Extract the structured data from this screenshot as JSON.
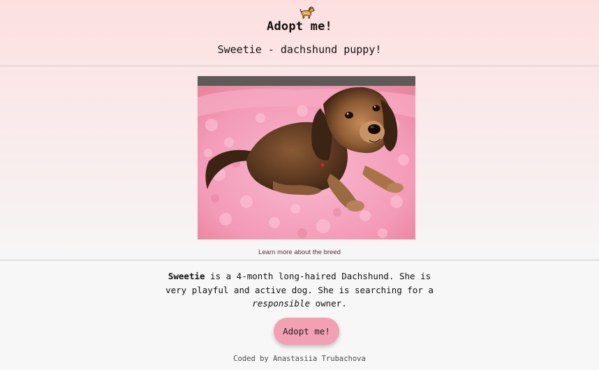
{
  "header": {
    "dog_icon": "dog-emoji-icon",
    "title": "Adopt me!",
    "subtitle": "Sweetie - dachshund puppy!"
  },
  "photo": {
    "alt": "Sweetie the dachshund puppy lying on a pink fluffy blanket"
  },
  "breed_link": "Learn more about the breed",
  "description": {
    "name": "Sweetie",
    "text_1": " is a 4-month long-haired Dachshund. She is very playful and active dog. She is searching for a ",
    "emphasis": "responsible",
    "text_2": " owner."
  },
  "adopt_button": "Adopt me!",
  "footer": "Coded by Anastasiia Trubachova",
  "colors": {
    "header_bg": "#fddfe0",
    "page_bg": "#f7f7f7",
    "button_bg": "#f3a0b4",
    "link_color": "#5a2e38",
    "blanket_pink": "#f4a6bf",
    "puppy_brown": "#6b4327"
  }
}
